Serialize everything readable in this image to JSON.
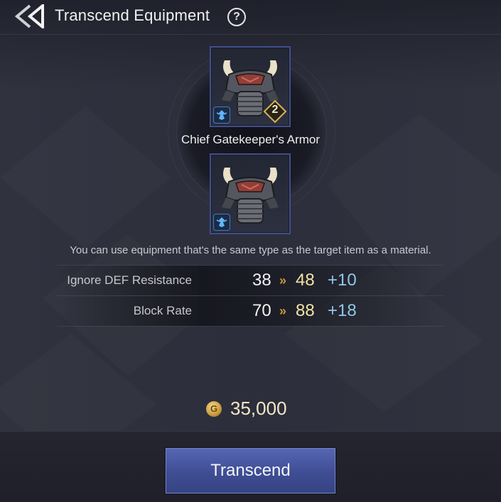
{
  "header": {
    "title": "Transcend Equipment",
    "back_icon": "double-chevron-left-icon",
    "help_icon": "question-icon",
    "help_label": "?"
  },
  "equipment": {
    "target_level": "2",
    "item_name": "Chief Gatekeeper's Armor",
    "type_icon": "class-emblem-icon"
  },
  "hint": "You can use equipment that's the same type as the target item as a material.",
  "stats": [
    {
      "label": "Ignore DEF Resistance",
      "old": "38",
      "arrow": "»",
      "new": "48",
      "diff": "+10"
    },
    {
      "label": "Block Rate",
      "old": "70",
      "arrow": "»",
      "new": "88",
      "diff": "+18"
    }
  ],
  "cost": {
    "coin_label": "G",
    "value": "35,000"
  },
  "button": {
    "label": "Transcend"
  },
  "colors": {
    "accent_button": "#4a59a6",
    "new_value": "#f2e3a4",
    "diff_value": "#8fc7e6",
    "arrow": "#c69a3e"
  }
}
